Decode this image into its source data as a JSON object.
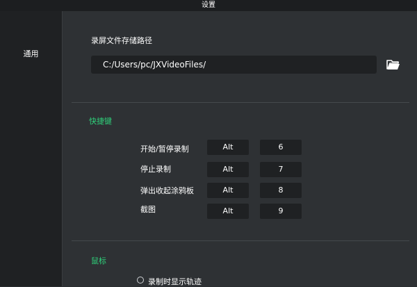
{
  "window": {
    "title": "设置"
  },
  "sidebar": {
    "items": [
      {
        "label": "通用"
      }
    ]
  },
  "storage": {
    "title": "录屏文件存储路径",
    "path": "C:/Users/pc/JXVideoFiles/",
    "folder_icon": "folder-open-icon"
  },
  "shortcuts": {
    "heading": "快捷键",
    "rows": [
      {
        "label": "开始/暂停录制",
        "modifier": "Alt",
        "key": "6"
      },
      {
        "label": "停止录制",
        "modifier": "Alt",
        "key": "7"
      },
      {
        "label": "弹出收起涂鸦板",
        "modifier": "Alt",
        "key": "8"
      },
      {
        "label": "截图",
        "modifier": "Alt",
        "key": "9"
      }
    ]
  },
  "mouse": {
    "heading": "鼠标",
    "show_trail_label": "录制时显示轨迹",
    "show_trail_checked": false
  },
  "colors": {
    "accent_green": "#2fd07a",
    "field_bg": "#1f2123",
    "panel_bg": "#2e3134"
  }
}
